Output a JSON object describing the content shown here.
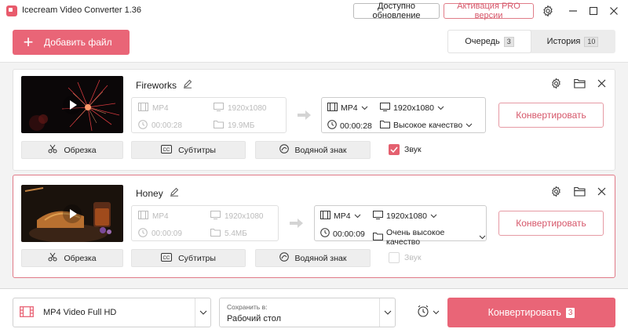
{
  "titlebar": {
    "app_title": "Icecream Video Converter 1.36",
    "update_label": "Доступно обновление",
    "pro_label": "Активация PRO версии"
  },
  "header": {
    "add_file_label": "Добавить файл",
    "tabs": [
      {
        "label": "Очередь",
        "count": "3"
      },
      {
        "label": "История",
        "count": "10"
      }
    ]
  },
  "items": [
    {
      "name": "Fireworks",
      "source": {
        "format": "MP4",
        "resolution": "1920x1080",
        "duration": "00:00:28",
        "size": "19.9МБ"
      },
      "target": {
        "format": "MP4",
        "resolution": "1920x1080",
        "duration": "00:00:28",
        "quality": "Высокое качество"
      },
      "convert_label": "Конвертировать",
      "tools": {
        "trim": "Обрезка",
        "subtitles": "Субтитры",
        "watermark": "Водяной знак",
        "sound": "Звук"
      },
      "sound_on": true
    },
    {
      "name": "Honey",
      "source": {
        "format": "MP4",
        "resolution": "1920x1080",
        "duration": "00:00:09",
        "size": "5.4МБ"
      },
      "target": {
        "format": "MP4",
        "resolution": "1920x1080",
        "duration": "00:00:09",
        "quality": "Очень высокое качество"
      },
      "convert_label": "Конвертировать",
      "tools": {
        "trim": "Обрезка",
        "subtitles": "Субтитры",
        "watermark": "Водяной знак",
        "sound": "Звук"
      },
      "sound_on": false
    }
  ],
  "footer": {
    "format_preset": "MP4 Video Full HD",
    "save_caption": "Сохранить в:",
    "save_value": "Рабочий стол",
    "convert_all_label": "Конвертировать",
    "convert_all_count": "3"
  },
  "colors": {
    "accent": "#e96577",
    "accent_text": "#d6576a"
  },
  "icons": [
    "app-logo-icon",
    "settings-icon",
    "minimize-icon",
    "maximize-icon",
    "close-icon",
    "plus-icon",
    "edit-icon",
    "folder-icon",
    "film-icon",
    "monitor-icon",
    "clock-icon",
    "arrow-right-icon",
    "scissors-icon",
    "cc-icon",
    "watermark-icon",
    "check-icon",
    "timer-icon",
    "chevron-down-icon",
    "play-icon"
  ]
}
